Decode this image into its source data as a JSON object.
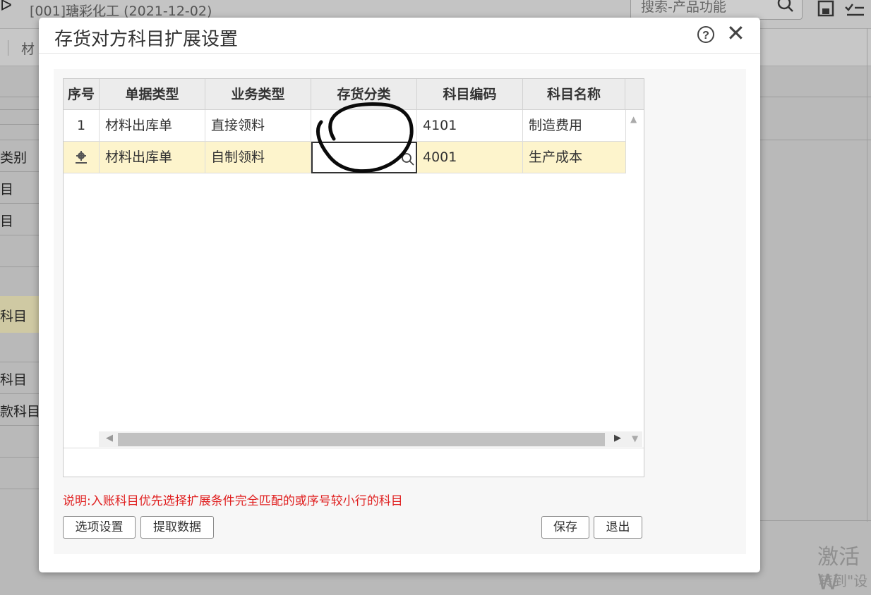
{
  "app": {
    "title": "[001]瑭彩化工  (2021-12-02)",
    "search_placeholder": "搜索-产品功能",
    "tab_partial": "材",
    "sidebar_items": [
      "类别",
      "目",
      "目",
      "科目",
      "科目",
      "款科目"
    ]
  },
  "watermark": {
    "line1": "激活 W",
    "line2": "转到\"设"
  },
  "dialog": {
    "title": "存货对方科目扩展设置",
    "help_icon": "question-circle-icon",
    "close_icon": "close-icon",
    "columns": [
      "序号",
      "单据类型",
      "业务类型",
      "存货分类",
      "科目编码",
      "科目名称"
    ],
    "rows": [
      {
        "seq": "1",
        "doc_type": "材料出库单",
        "biz_type": "直接领料",
        "inv_class": "",
        "account_code": "4101",
        "account_name": "制造费用"
      },
      {
        "seq": "",
        "doc_type": "材料出库单",
        "biz_type": "自制领料",
        "inv_class": "",
        "account_code": "4001",
        "account_name": "生产成本",
        "selected": true
      }
    ],
    "note": "说明:入账科目优先选择扩展条件完全匹配的或序号较小行的科目",
    "buttons": {
      "options": "选项设置",
      "fetch": "提取数据",
      "save": "保存",
      "exit": "退出"
    }
  },
  "colors": {
    "selected_row": "#fdf4cc",
    "note_red": "#e02020",
    "header_bg": "#ececec"
  }
}
